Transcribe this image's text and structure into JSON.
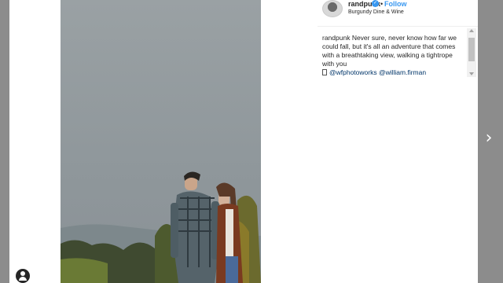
{
  "post": {
    "username": "randpunk",
    "follow_label": "Follow",
    "dot": "•",
    "location": "Burgundy Dine & Wine",
    "caption_user": "randpunk",
    "caption_text": " Never sure, never know how far we could fall, but it's all an adventure that comes with a breathtaking view, walking a tightrope with you",
    "mentions": [
      "@wfphotoworks",
      "@william.firman"
    ]
  },
  "icons": {
    "verified": "verified-badge-icon",
    "next": "chevron-right-icon",
    "profile": "profile-icon"
  },
  "colors": {
    "accent": "#3897f0",
    "mention": "#003569",
    "overlay": "#8c8c8c"
  }
}
